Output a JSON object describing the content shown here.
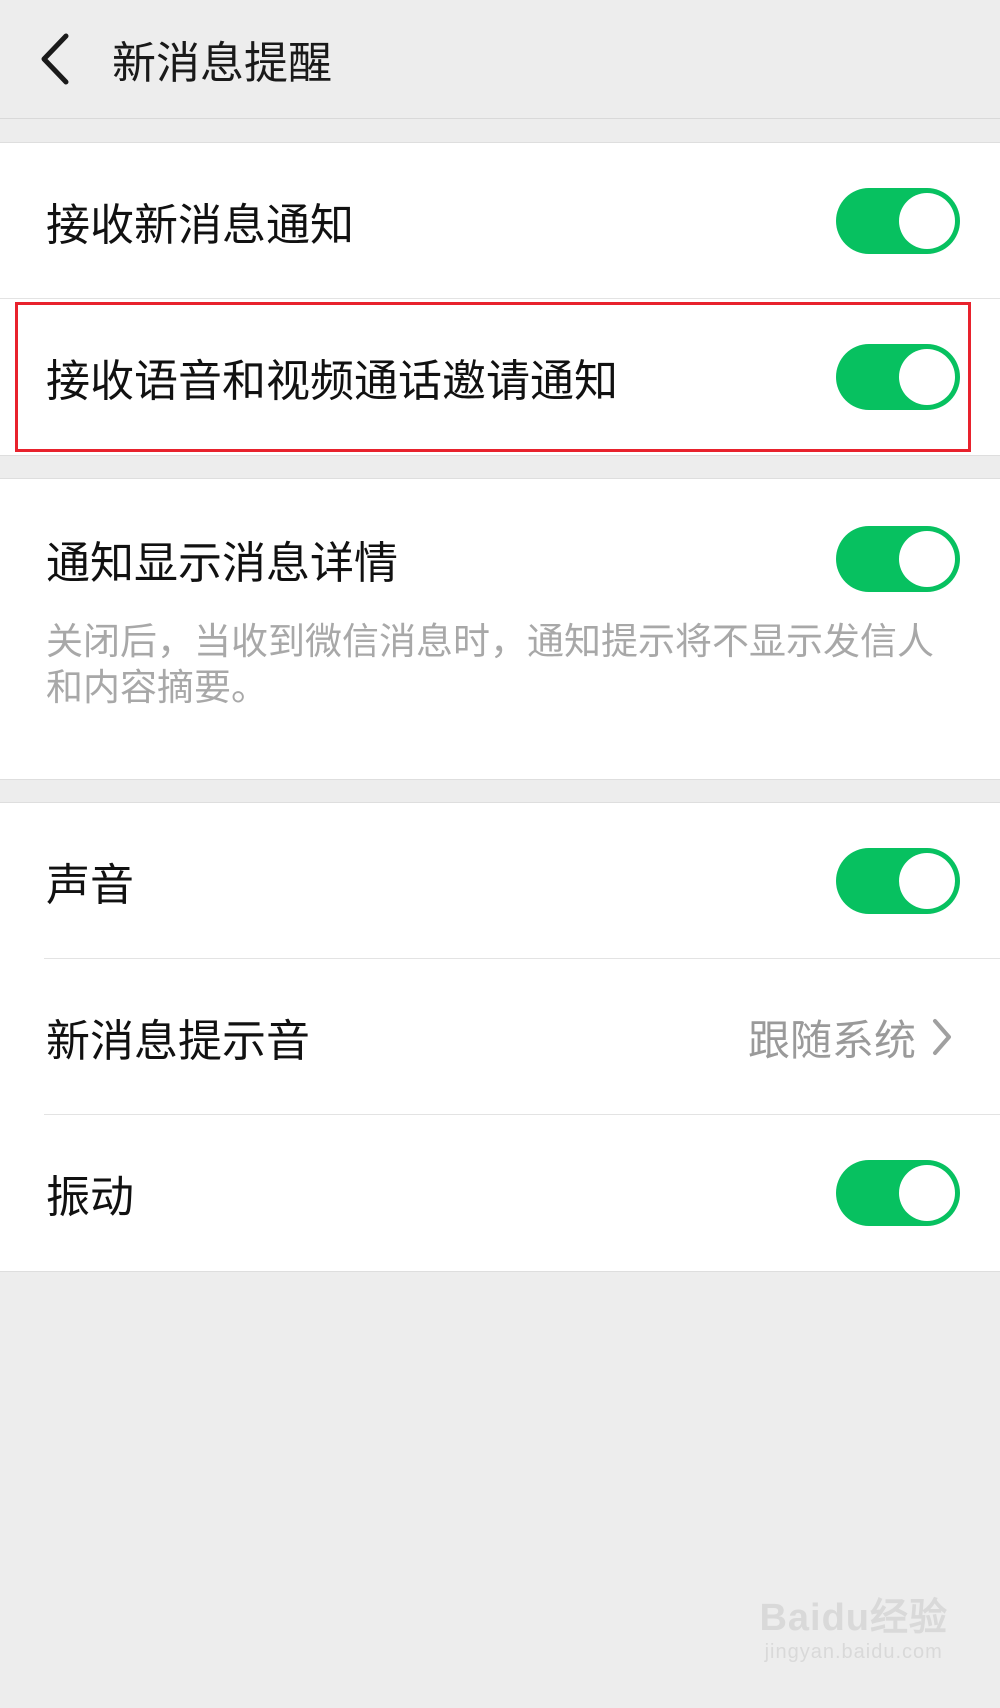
{
  "header": {
    "title": "新消息提醒",
    "back_icon": "chevron-left-icon"
  },
  "groups": {
    "notify": {
      "receive_new": {
        "label": "接收新消息通知",
        "enabled": true
      },
      "receive_call_invite": {
        "label": "接收语音和视频通话邀请通知",
        "enabled": true
      }
    },
    "details": {
      "show_details": {
        "label": "通知显示消息详情",
        "enabled": true
      },
      "description": "关闭后，当收到微信消息时，通知提示将不显示发信人和内容摘要。"
    },
    "sound": {
      "sound": {
        "label": "声音",
        "enabled": true
      },
      "tone": {
        "label": "新消息提示音",
        "value": "跟随系统",
        "icon": "chevron-right-icon"
      },
      "vibrate": {
        "label": "振动",
        "enabled": true
      }
    }
  },
  "colors": {
    "switch_on": "#07c160",
    "highlight": "#e8222d",
    "background": "#ededed"
  },
  "watermark": {
    "main": "Baidu经验",
    "sub": "jingyan.baidu.com"
  }
}
